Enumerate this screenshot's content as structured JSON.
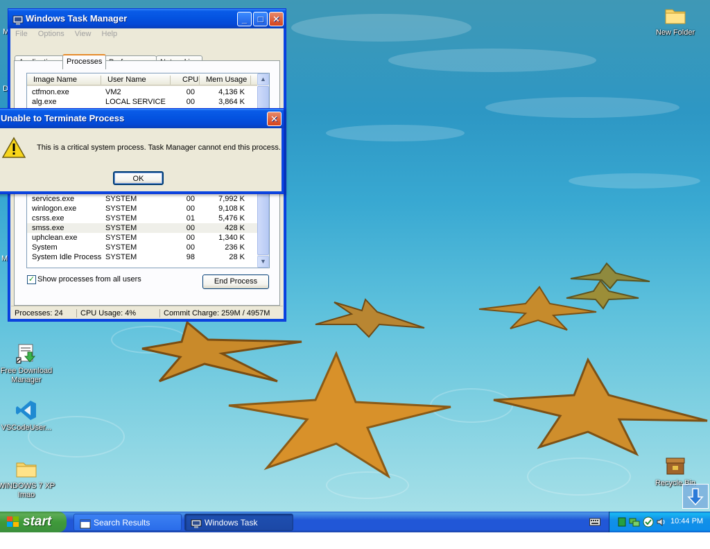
{
  "desktop": {
    "icons": [
      {
        "label": "New Folder"
      },
      {
        "label": "Free Download Manager"
      },
      {
        "label": "VSCodeUser..."
      },
      {
        "label": "WINDOWS 7 XP Imao"
      },
      {
        "label": "Recycle Bin"
      }
    ],
    "partial_labels": [
      "D",
      "M",
      "M"
    ]
  },
  "task_manager": {
    "title": "Windows Task Manager",
    "menu": [
      "File",
      "Options",
      "View",
      "Help"
    ],
    "tabs": [
      "Applications",
      "Processes",
      "Performance",
      "Networking"
    ],
    "active_tab": "Processes",
    "columns": [
      "Image Name",
      "User Name",
      "CPU",
      "Mem Usage"
    ],
    "rows_top": [
      {
        "image": "ctfmon.exe",
        "user": "VM2",
        "cpu": "00",
        "mem": "4,136 K"
      },
      {
        "image": "alg.exe",
        "user": "LOCAL SERVICE",
        "cpu": "00",
        "mem": "3,864 K"
      }
    ],
    "rows_bottom": [
      {
        "image": "services.exe",
        "user": "SYSTEM",
        "cpu": "00",
        "mem": "7,992 K"
      },
      {
        "image": "winlogon.exe",
        "user": "SYSTEM",
        "cpu": "00",
        "mem": "9,108 K"
      },
      {
        "image": "csrss.exe",
        "user": "SYSTEM",
        "cpu": "01",
        "mem": "5,476 K"
      },
      {
        "image": "smss.exe",
        "user": "SYSTEM",
        "cpu": "00",
        "mem": "428 K"
      },
      {
        "image": "uphclean.exe",
        "user": "SYSTEM",
        "cpu": "00",
        "mem": "1,340 K"
      },
      {
        "image": "System",
        "user": "SYSTEM",
        "cpu": "00",
        "mem": "236 K"
      },
      {
        "image": "System Idle Process",
        "user": "SYSTEM",
        "cpu": "98",
        "mem": "28 K"
      }
    ],
    "show_all_label": "Show processes from all users",
    "show_all_checked": true,
    "end_process_label": "End Process",
    "status": {
      "processes": "Processes: 24",
      "cpu": "CPU Usage: 4%",
      "commit": "Commit Charge: 259M / 4957M"
    }
  },
  "dialog": {
    "title": "Unable to Terminate Process",
    "message": "This is a critical system process.  Task Manager cannot end this process.",
    "ok_label": "OK",
    "icon": "warning-icon"
  },
  "taskbar": {
    "start_label": "start",
    "buttons": [
      {
        "label": "Search Results"
      },
      {
        "label": "Windows Task Manager"
      }
    ],
    "clock": "10:44 PM"
  },
  "colors": {
    "xp_blue": "#0a46e0",
    "start_green": "#3f9a3a",
    "tray_blue": "#1290e8",
    "close_red": "#d4421b"
  }
}
